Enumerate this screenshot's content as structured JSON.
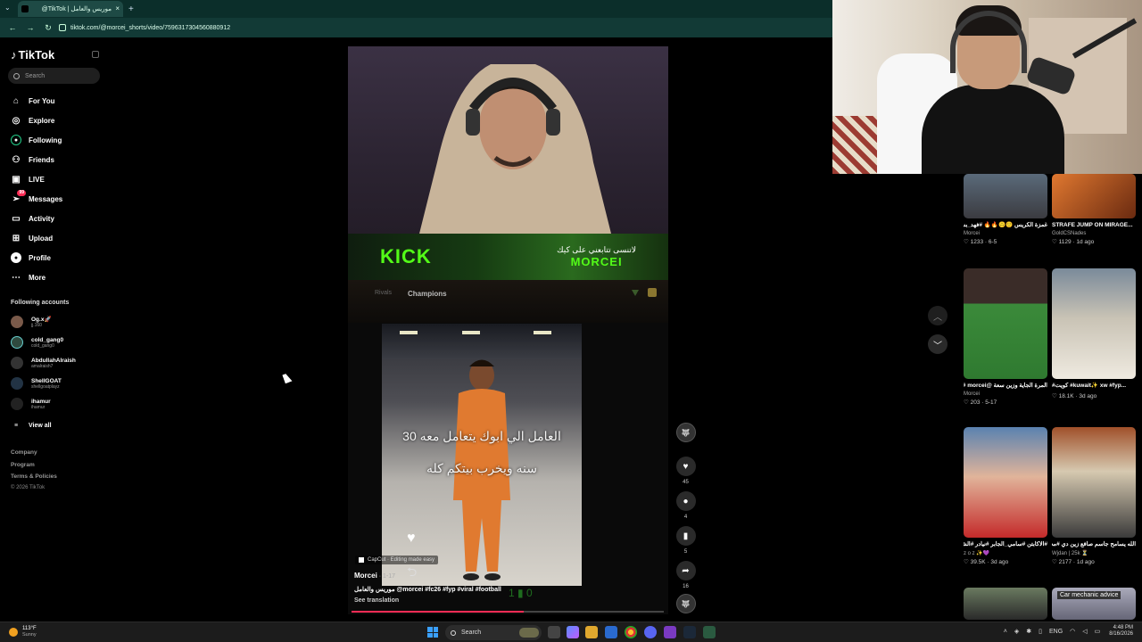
{
  "browser": {
    "tab_title": "موريس والعامل | TikTok@",
    "tab_close": "×",
    "new_tab": "+",
    "url": "tiktok.com/@morcei_shorts/video/7596317304560880912",
    "nav_back": "←",
    "nav_forward": "→",
    "nav_reload": "↻"
  },
  "sidebar": {
    "logo": "TikTok",
    "search_placeholder": "Search",
    "nav": [
      {
        "label": "For You",
        "icon": "home-icon"
      },
      {
        "label": "Explore",
        "icon": "compass-icon"
      },
      {
        "label": "Following",
        "icon": "following-icon"
      },
      {
        "label": "Friends",
        "icon": "friends-icon"
      },
      {
        "label": "LIVE",
        "icon": "live-icon"
      },
      {
        "label": "Messages",
        "icon": "messages-icon",
        "badge": "99"
      },
      {
        "label": "Activity",
        "icon": "activity-icon"
      },
      {
        "label": "Upload",
        "icon": "upload-icon"
      },
      {
        "label": "Profile",
        "icon": "profile-icon"
      },
      {
        "label": "More",
        "icon": "more-icon"
      }
    ],
    "following_title": "Following accounts",
    "accounts": [
      {
        "name": "Og.x🚀",
        "handle": "jj.160"
      },
      {
        "name": "cold_gang0",
        "handle": "cold_gang0"
      },
      {
        "name": "AbdullahAlraish",
        "handle": "amalraish7"
      },
      {
        "name": "ShellGOAT",
        "handle": "shellgoatplayz"
      },
      {
        "name": "ihamur",
        "handle": "ihamur"
      }
    ],
    "view_all": "View all",
    "footer": [
      "Company",
      "Program",
      "Terms & Policies"
    ],
    "copyright": "© 2026 TikTok"
  },
  "video": {
    "kick_logo": "KICK",
    "kick_arabic": "لاتنسى تتابعني على كيك",
    "kick_name": "MORCEI",
    "tab_rivals": "Rivals",
    "tab_champions": "Champions",
    "overlay_line1": "العامل الي ابوك يتعامل معه 30",
    "overlay_line2": "سنه ويخرب بيتكم كله",
    "capcut": "CapCut · Editing made easy",
    "author": "Morcei",
    "date": " · 1-17",
    "caption": "موريس والعامل @morcei #fc26 #fyp #viral #football",
    "see_translation": "See translation",
    "progress": 0.55
  },
  "actions": {
    "likes": "45",
    "comments": "4",
    "saves": "5",
    "shares": "16"
  },
  "suggestions": [
    {
      "title": "غمزة الكريس 🙂🙃🔥🔥 #فهد_بسيك #نتائج_كاس...",
      "author": "Morcei",
      "stats": "♡ 1233 · 6-5"
    },
    {
      "title": "STRAFE JUMP ON MIRAGE...",
      "author": "GoldCSNades",
      "stats": "♡ 1129 · 1d ago"
    },
    {
      "title": "المرة الجاية وزين سعة @morcei #الكابتن...",
      "author": "Morcei",
      "stats": "♡ 203 · 5-17"
    },
    {
      "title": "#كويت #kuwait✨ xw #fyp...",
      "author": "",
      "stats": "♡ 18.1K · 3d ago"
    },
    {
      "title": "#الاكابتن #سامي_الجابر #نيادر #الشعب_المصري_الاهلي🤩",
      "author": "z o z ✨💜",
      "stats": "♡ 39.5K · 3d ago"
    },
    {
      "title": "الله يسامح جاسم صافع زين دي #محمد_القحطاني #مدارة",
      "author": "Wjdan | 25k ⏳",
      "stats": "♡ 2177 · 1d ago"
    },
    {
      "title": "",
      "author": "",
      "stats": ""
    },
    {
      "title": "Car mechanic advice",
      "author": "",
      "stats": ""
    }
  ],
  "taskbar": {
    "temp": "113°F",
    "condition": "Sunny",
    "search": "Search",
    "lang": "ENG",
    "time": "4:48 PM",
    "date": "8/16/2026"
  },
  "colors": {
    "accent": "#fe2c55",
    "kick_green": "#53fc18",
    "chrome_dark": "#0b2e2a"
  }
}
